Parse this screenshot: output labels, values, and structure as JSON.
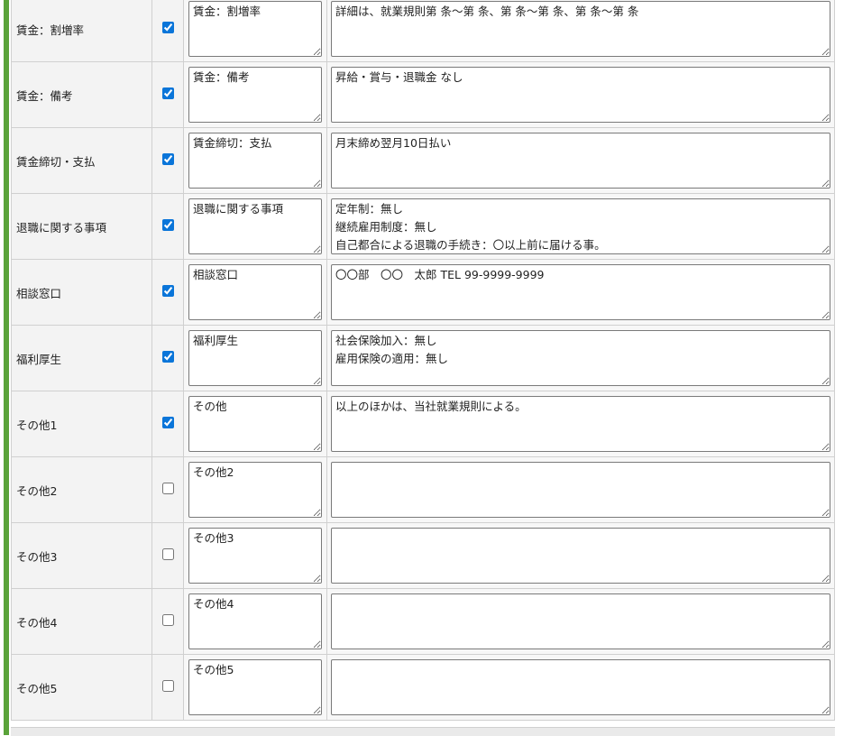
{
  "rows": [
    {
      "label": "賃金：割増率",
      "checked": true,
      "title": "賃金：割増率",
      "body": "詳細は、就業規則第 条～第 条、第 条～第 条、第 条～第 条"
    },
    {
      "label": "賃金：備考",
      "checked": true,
      "title": "賃金：備考",
      "body": "昇給・賞与・退職金 なし"
    },
    {
      "label": "賃金締切・支払",
      "checked": true,
      "title": "賃金締切：支払",
      "body": "月末締め翌月10日払い"
    },
    {
      "label": "退職に関する事項",
      "checked": true,
      "title": "退職に関する事項",
      "body": "定年制：無し\n継続雇用制度：無し\n自己都合による退職の手続き：〇以上前に届ける事。"
    },
    {
      "label": "相談窓口",
      "checked": true,
      "title": "相談窓口",
      "body": "〇〇部　〇〇　太郎 TEL 99-9999-9999"
    },
    {
      "label": "福利厚生",
      "checked": true,
      "title": "福利厚生",
      "body": "社会保険加入：無し\n雇用保険の適用：無し"
    },
    {
      "label": "その他1",
      "checked": true,
      "title": "その他",
      "body": "以上のほかは、当社就業規則による。"
    },
    {
      "label": "その他2",
      "checked": false,
      "title": "その他2",
      "body": ""
    },
    {
      "label": "その他3",
      "checked": false,
      "title": "その他3",
      "body": ""
    },
    {
      "label": "その他4",
      "checked": false,
      "title": "その他4",
      "body": ""
    },
    {
      "label": "その他5",
      "checked": false,
      "title": "その他5",
      "body": ""
    }
  ],
  "colors": {
    "accent_bar": "#5aa33a",
    "checkbox": "#0a75d9"
  }
}
